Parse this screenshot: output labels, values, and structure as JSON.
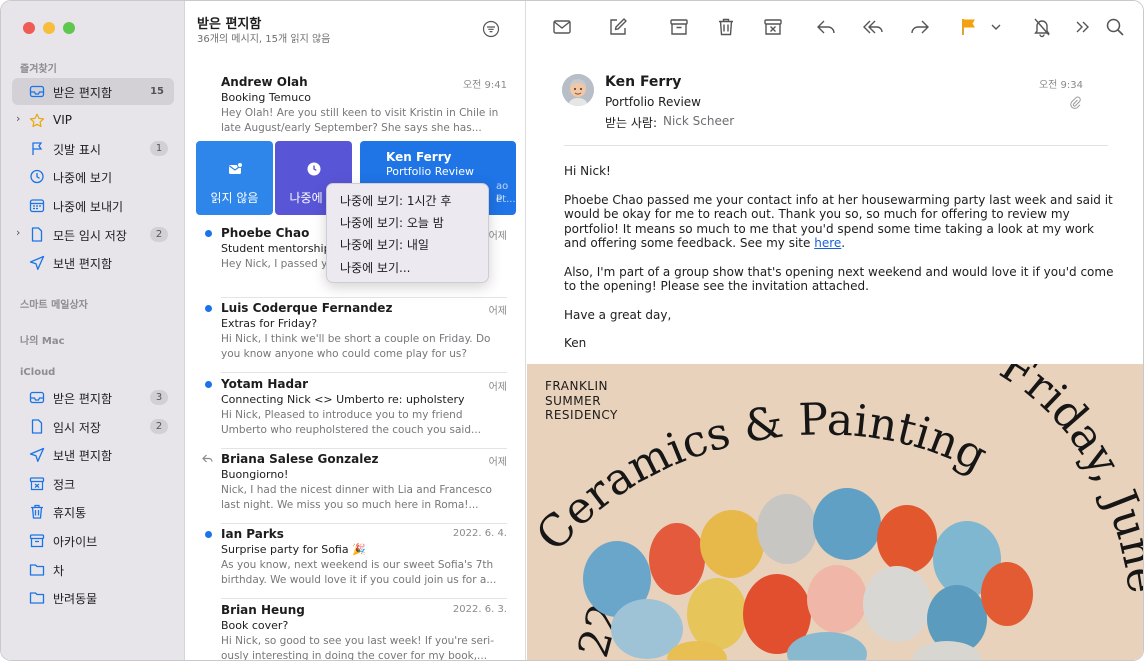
{
  "sidebar": {
    "sections": {
      "favorites": "즐겨찾기",
      "smart": "스마트 메일상자",
      "mymac": "나의 Mac",
      "icloud": "iCloud"
    },
    "favorites": [
      {
        "label": "받은 편지함",
        "count": "15",
        "icon": "inbox-icon"
      },
      {
        "label": "VIP",
        "icon": "star-icon"
      },
      {
        "label": "깃발 표시",
        "count": "1",
        "icon": "flag-icon"
      },
      {
        "label": "나중에 보기",
        "icon": "clock-icon"
      },
      {
        "label": "나중에 보내기",
        "icon": "calendar-icon"
      },
      {
        "label": "모든 임시 저장",
        "count": "2",
        "icon": "document-icon"
      },
      {
        "label": "보낸 편지함",
        "icon": "paperplane-icon"
      }
    ],
    "icloud": [
      {
        "label": "받은 편지함",
        "count": "3",
        "icon": "inbox-icon"
      },
      {
        "label": "임시 저장",
        "count": "2",
        "icon": "document-icon"
      },
      {
        "label": "보낸 편지함",
        "icon": "paperplane-icon"
      },
      {
        "label": "정크",
        "icon": "junk-icon"
      },
      {
        "label": "휴지통",
        "icon": "trash-icon"
      },
      {
        "label": "아카이브",
        "icon": "archive-icon"
      },
      {
        "label": "차",
        "icon": "folder-icon"
      },
      {
        "label": "반려동물",
        "icon": "folder-icon"
      }
    ]
  },
  "list": {
    "title": "받은 편지함",
    "subtitle": "36개의 메시지, 15개 읽지 않음",
    "messages": [
      {
        "from": "Andrew Olah",
        "date": "오전 9:41",
        "subject": "Booking Temuco",
        "preview": "Hey Olah! Are you still keen to visit Kristin in Chile in late August/early September? She says she has..."
      },
      {
        "from": "Phoebe Chao",
        "date": "어제",
        "subject": "Student mentorship",
        "preview": "Hey Nick, I passed y... ue I was telling you abo..."
      },
      {
        "from": "Luis Coderque Fernandez",
        "date": "어제",
        "subject": "Extras for Friday?",
        "preview": "Hi Nick, I think we'll be short a couple on Friday. Do you know anyone who could come play for us?"
      },
      {
        "from": "Yotam Hadar",
        "date": "어제",
        "subject": "Connecting Nick <> Umberto re: upholstery",
        "preview": "Hi Nick, Pleased to introduce you to my friend Umberto who reupholstered the couch you said..."
      },
      {
        "from": "Briana Salese Gonzalez",
        "date": "어제",
        "subject": "Buongiorno!",
        "preview": "Nick, I had the nicest dinner with Lia and Francesco last night. We miss you so much here in Roma!..."
      },
      {
        "from": "Ian Parks",
        "date": "2022. 6. 4.",
        "subject": "Surprise party for Sofia 🎉",
        "preview": "As you know, next weekend is our sweet Sofia's 7th birthday. We would love it if you could join us for a..."
      },
      {
        "from": "Brian Heung",
        "date": "2022. 6. 3.",
        "subject": "Book cover?",
        "preview": "Hi Nick, so good to see you last week! If you're seri-ously interesting in doing the cover for my book,..."
      }
    ],
    "swipe": {
      "unread_label": "읽지 않음",
      "later_label": "나중에 보",
      "row_from": "Ken Ferry",
      "row_subject": "Portfolio Review",
      "row_frag1": "ao p",
      "row_frag2": "et..."
    }
  },
  "menu": {
    "items": [
      "나중에 보기: 1시간 후",
      "나중에 보기: 오늘 밤",
      "나중에 보기: 내일",
      "나중에 보기..."
    ]
  },
  "reader": {
    "toolbar": [
      "envelope-icon",
      "compose-icon",
      "archive-icon",
      "trash-icon",
      "junk-icon",
      "reply-icon",
      "reply-all-icon",
      "forward-icon",
      "flag-icon",
      "chevron-down-icon",
      "bell-slash-icon",
      "more-icon",
      "search-icon"
    ],
    "from": "Ken Ferry",
    "subject": "Portfolio Review",
    "to_label": "받는 사람:",
    "to": "Nick Scheer",
    "date": "오전 9:34",
    "body": {
      "greeting": "Hi Nick!",
      "p1": "Phoebe Chao passed me your contact info at her housewarming party last week and said it would be okay for me to reach out. Thank you so, so much for offering to review my portfolio! It means so much to me that you'd spend some time taking a look at my work and offering some feedback. See my site ",
      "p1_link": "here",
      "p1_end": ".",
      "p2": "Also, I'm part of a group show that's opening next weekend and would love it if you'd come to the opening! Please see the invitation attached.",
      "p3": "Have a great day,",
      "sign": "Ken"
    },
    "poster": {
      "org": [
        "FRANKLIN",
        "SUMMER",
        "RESIDENCY"
      ],
      "headline": "Ceramics & Painting",
      "date_text": "Friday, June",
      "year_frag": "22"
    }
  },
  "colors": {
    "accent": "#1a73e8",
    "swipe_blue": "#2e86ea",
    "swipe_purple": "#5856d6",
    "flag_orange": "#f5a00c",
    "poster_bg": "#e9d2bb"
  }
}
